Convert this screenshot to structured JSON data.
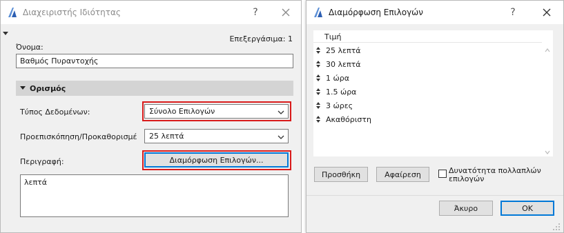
{
  "left_window": {
    "title": "Διαχειριστής Ιδιότητας",
    "help": "?",
    "edit_count": "Επεξεργάσιμα: 1",
    "name_label": "Όνομα:",
    "name_value": "Βαθμός Πυραντοχής",
    "section_title": "Ορισμός",
    "data_type_label": "Τύπος Δεδομένων:",
    "data_type_value": "Σύνολο Επιλογών",
    "preview_label": "Προεπισκόπηση/Προκαθορισμέ",
    "preview_value": "25 λεπτά",
    "description_label": "Περιγραφή:",
    "configure_button": "Διαμόρφωση Επιλογών...",
    "description_text": "λεπτά"
  },
  "right_window": {
    "title": "Διαμόρφωση Επιλογών",
    "help": "?",
    "list_header": "Τιμή",
    "options": [
      "25 λεπτά",
      "30 λεπτά",
      "1 ώρα",
      "1.5 ώρα",
      "3 ώρες",
      "Ακαθόριστη"
    ],
    "add_button": "Προσθήκη",
    "remove_button": "Αφαίρεση",
    "multi_select_label_line1": "Δυνατότητα πολλαπλών",
    "multi_select_label_line2": "επιλογών",
    "multi_select_checked": false,
    "cancel_button": "Άκυρο",
    "ok_button": "ΟΚ"
  },
  "colors": {
    "highlight_red": "#d91a1a",
    "focus_blue": "#0078d7",
    "dialog_bg": "#f0f0f0",
    "section_bg": "#d4d4d4"
  }
}
